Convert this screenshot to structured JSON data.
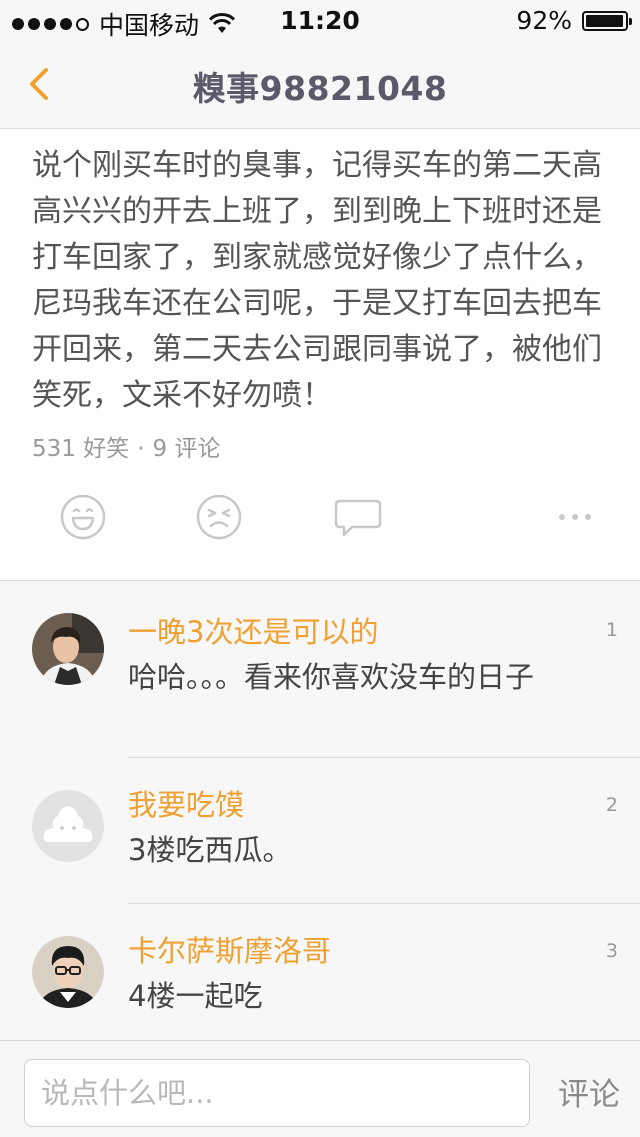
{
  "status_bar": {
    "carrier": "中国移动",
    "time": "11:20",
    "battery": "92%"
  },
  "nav": {
    "title": "糗事98821048",
    "back_icon": "chevron-left-icon",
    "accent_color": "#f0a030"
  },
  "post": {
    "content": "说个刚买车时的臭事，记得买车的第二天高高兴兴的开去上班了，到到晚上下班时还是打车回家了，到家就感觉好像少了点什么，尼玛我车还在公司呢，于是又打车回去把车开回来，第二天去公司跟同事说了，被他们笑死，文采不好勿喷！",
    "stats": {
      "funny": "531 好笑",
      "separator": "·",
      "comments": "9 评论"
    },
    "actions": [
      {
        "icon": "smile-icon"
      },
      {
        "icon": "dislike-face-icon"
      },
      {
        "icon": "speech-bubble-icon"
      },
      {
        "icon": "more-dots-icon"
      }
    ]
  },
  "comments": [
    {
      "user": "一晚3次还是可以的",
      "text": "哈哈。。。看来你喜欢没车的日子",
      "floor": "1",
      "avatar": "user-photo-avatar"
    },
    {
      "user": "我要吃馍",
      "text": "3楼吃西瓜。",
      "floor": "2",
      "avatar": "default-avatar"
    },
    {
      "user": "卡尔萨斯摩洛哥",
      "text": "4楼一起吃",
      "floor": "3",
      "avatar": "user-photo-avatar"
    }
  ],
  "input_bar": {
    "placeholder": "说点什么吧...",
    "submit_label": "评论"
  }
}
